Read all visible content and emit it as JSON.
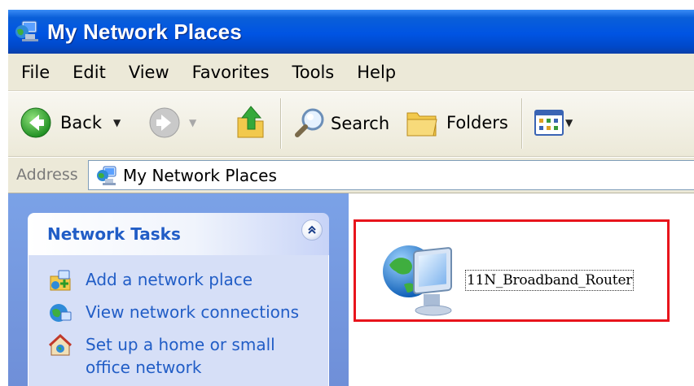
{
  "window": {
    "title": "My Network Places"
  },
  "menu": [
    "File",
    "Edit",
    "View",
    "Favorites",
    "Tools",
    "Help"
  ],
  "toolbar": {
    "back_label": "Back",
    "search_label": "Search",
    "folders_label": "Folders"
  },
  "address": {
    "label": "Address",
    "value": "My Network Places"
  },
  "tasks": {
    "title": "Network Tasks",
    "items": [
      {
        "label": "Add a network place",
        "icon": "add-network-place-icon"
      },
      {
        "label": "View network connections",
        "icon": "network-connections-icon"
      },
      {
        "label": "Set up a home or small office network",
        "icon": "home-network-icon"
      }
    ]
  },
  "content": {
    "items": [
      {
        "label": "11N_Broadband_Router",
        "icon": "network-computer-icon"
      }
    ]
  },
  "colors": {
    "titlebar": "#0054e3",
    "taskpane": "#6f8fd8",
    "task_link": "#215dc6",
    "highlight": "#e8141c"
  }
}
